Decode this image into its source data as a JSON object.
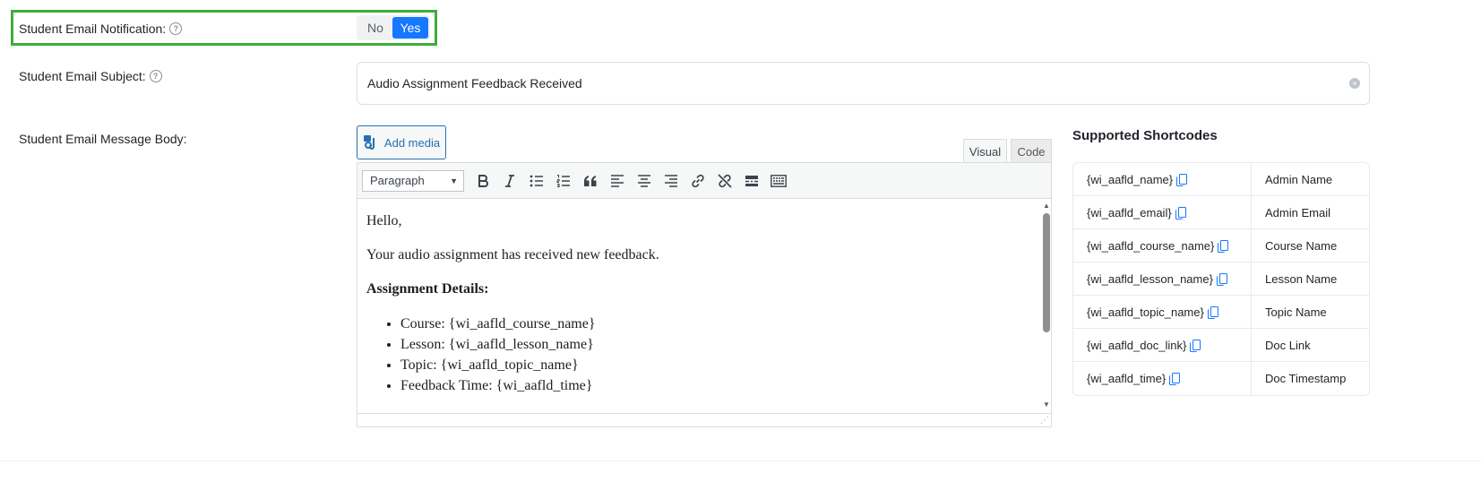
{
  "notification": {
    "label": "Student Email Notification:",
    "toggle_no": "No",
    "toggle_yes": "Yes",
    "selected": "Yes",
    "highlight_color": "#3fad3a",
    "accent_color": "#1677ff"
  },
  "subject": {
    "label": "Student Email Subject:",
    "value": "Audio Assignment Feedback Received",
    "clear_icon": "close-circle-icon"
  },
  "body": {
    "label": "Student Email Message Body:",
    "add_media_label": "Add media",
    "tabs": {
      "visual": "Visual",
      "code": "Code"
    },
    "format_select": "Paragraph",
    "toolbar_icons": [
      "bold-icon",
      "italic-icon",
      "bullet-list-icon",
      "numbered-list-icon",
      "blockquote-icon",
      "align-left-icon",
      "align-center-icon",
      "align-right-icon",
      "link-icon",
      "unlink-icon",
      "read-more-icon",
      "toolbar-toggle-icon"
    ],
    "content": {
      "greeting": "Hello,",
      "intro": "Your audio assignment has received new feedback.",
      "details_heading": "Assignment Details:",
      "items": [
        "Course: {wi_aafld_course_name}",
        "Lesson: {wi_aafld_lesson_name}",
        "Topic: {wi_aafld_topic_name}",
        "Feedback Time: {wi_aafld_time}"
      ]
    }
  },
  "shortcodes": {
    "title": "Supported Shortcodes",
    "rows": [
      {
        "code": "{wi_aafld_name}",
        "desc": "Admin Name"
      },
      {
        "code": "{wi_aafld_email}",
        "desc": "Admin Email"
      },
      {
        "code": "{wi_aafld_course_name}",
        "desc": "Course Name"
      },
      {
        "code": "{wi_aafld_lesson_name}",
        "desc": "Lesson Name"
      },
      {
        "code": "{wi_aafld_topic_name}",
        "desc": "Topic Name"
      },
      {
        "code": "{wi_aafld_doc_link}",
        "desc": "Doc Link"
      },
      {
        "code": "{wi_aafld_time}",
        "desc": "Doc Timestamp"
      }
    ]
  }
}
